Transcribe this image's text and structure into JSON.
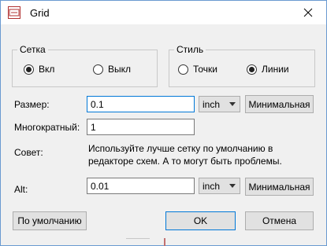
{
  "window": {
    "title": "Grid",
    "app_icon": "sch-icon",
    "close_icon": "close-icon"
  },
  "grid_group": {
    "legend": "Сетка",
    "options": [
      {
        "label": "Вкл",
        "checked": true
      },
      {
        "label": "Выкл",
        "checked": false
      }
    ]
  },
  "style_group": {
    "legend": "Стиль",
    "options": [
      {
        "label": "Точки",
        "checked": false
      },
      {
        "label": "Линии",
        "checked": true
      }
    ]
  },
  "size": {
    "label": "Размер:",
    "value": "0.1",
    "unit": "inch",
    "button": "Минимальная"
  },
  "multiple": {
    "label": "Многократный:",
    "value": "1"
  },
  "hint": {
    "label": "Совет:",
    "text": "Используйте лучше сетку по умолчанию в редакторе схем. А то могут быть проблемы."
  },
  "alt": {
    "label": "Alt:",
    "value": "0.01",
    "unit": "inch",
    "button": "Минимальная"
  },
  "footer": {
    "default_button": "По умолчанию",
    "ok_button": "OK",
    "cancel_button": "Отмена"
  },
  "colors": {
    "accent": "#0078d7",
    "border": "#6a9ad1",
    "background": "#f0f0f0"
  }
}
